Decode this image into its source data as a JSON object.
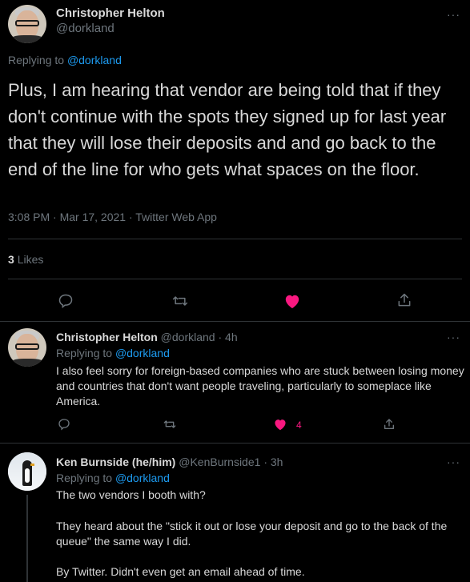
{
  "main_tweet": {
    "author_name": "Christopher Helton",
    "author_handle": "@dorkland",
    "replying_prefix": "Replying to",
    "replying_to": "@dorkland",
    "text": "Plus, I am hearing that vendor are being told that if they don't continue with the spots they signed up for last year that they will lose their deposits and and go back to the end of the line for who gets what spaces on the floor.",
    "timestamp": "3:08 PM · Mar 17, 2021 · Twitter Web App",
    "likes_count": "3",
    "likes_label": "Likes",
    "liked": true,
    "more_label": "···"
  },
  "replies": [
    {
      "author_name": "Christopher Helton",
      "author_handle": "@dorkland",
      "time": "· 4h",
      "replying_prefix": "Replying to",
      "replying_to": "@dorkland",
      "text": "I also feel sorry for foreign-based companies who are stuck between losing money and countries that don't want people traveling, particularly to someplace like America.",
      "like_count": "4",
      "liked": true,
      "more_label": "···"
    },
    {
      "author_name": "Ken Burnside (he/him)",
      "author_handle": "@KenBurnside1",
      "time": "· 3h",
      "replying_prefix": "Replying to",
      "replying_to": "@dorkland",
      "text_lines": [
        "The two vendors I booth with?",
        "They heard about the \"stick it out or lose your deposit and go to the back of the queue\" the same way I did.",
        "By Twitter. Didn't even get an email ahead of time."
      ],
      "more_label": "···"
    }
  ],
  "colors": {
    "background": "#000000",
    "text": "#d9d9d9",
    "muted": "#6e767d",
    "link": "#1d9bf0",
    "like": "#f91880",
    "divider": "#2f3336"
  },
  "icons": [
    "reply-icon",
    "retweet-icon",
    "like-icon",
    "share-icon",
    "more-icon"
  ]
}
